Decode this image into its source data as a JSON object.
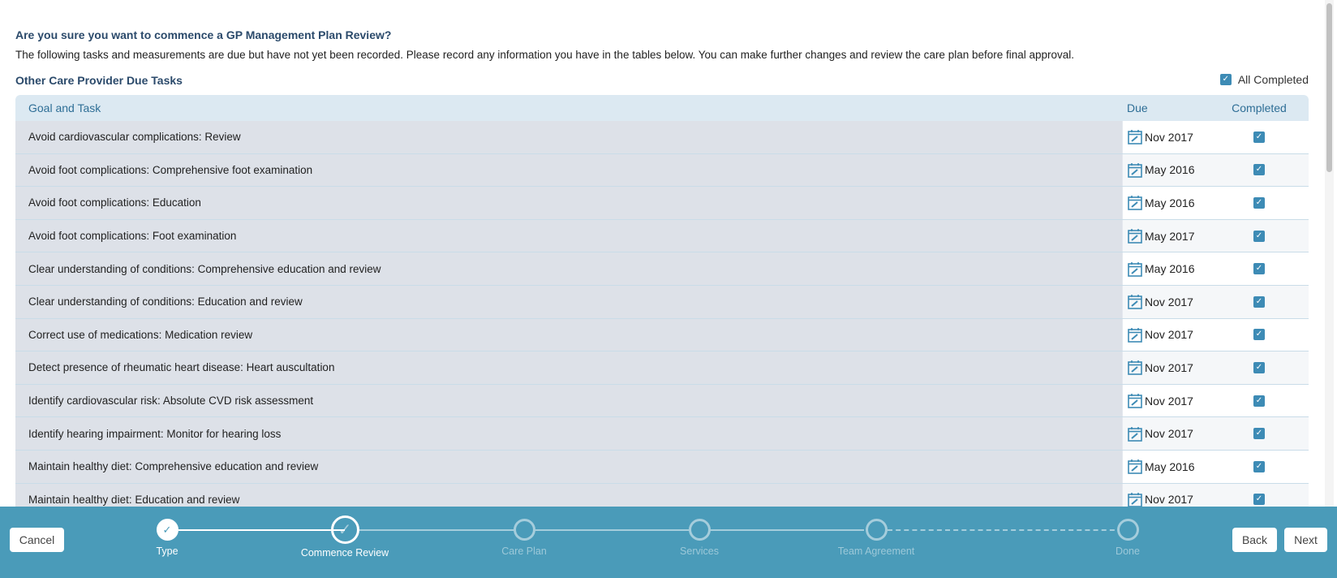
{
  "title": "Are you sure you want to commence a GP Management Plan Review?",
  "description": "The following tasks and measurements are due but have not yet been recorded. Please record any information you have in the tables below. You can make further changes and review the care plan before final approval.",
  "section_title": "Other Care Provider Due Tasks",
  "all_completed_label": "All Completed",
  "columns": {
    "goal": "Goal and Task",
    "due": "Due",
    "completed": "Completed"
  },
  "rows": [
    {
      "task": "Avoid cardiovascular complications: Review",
      "due": "Nov 2017"
    },
    {
      "task": "Avoid foot complications: Comprehensive foot examination",
      "due": "May 2016"
    },
    {
      "task": "Avoid foot complications: Education",
      "due": "May 2016"
    },
    {
      "task": "Avoid foot complications: Foot examination",
      "due": "May 2017"
    },
    {
      "task": "Clear understanding of conditions: Comprehensive education and review",
      "due": "May 2016"
    },
    {
      "task": "Clear understanding of conditions: Education and review",
      "due": "Nov 2017"
    },
    {
      "task": "Correct use of medications: Medication review",
      "due": "Nov 2017"
    },
    {
      "task": "Detect presence of rheumatic heart disease: Heart auscultation",
      "due": "Nov 2017"
    },
    {
      "task": "Identify cardiovascular risk: Absolute CVD risk assessment",
      "due": "Nov 2017"
    },
    {
      "task": "Identify hearing impairment: Monitor for hearing loss",
      "due": "Nov 2017"
    },
    {
      "task": "Maintain healthy diet: Comprehensive education and review",
      "due": "May 2016"
    },
    {
      "task": "Maintain healthy diet: Education and review",
      "due": "Nov 2017"
    }
  ],
  "footer": {
    "cancel": "Cancel",
    "back": "Back",
    "next": "Next",
    "steps": [
      {
        "label": "Type",
        "state": "done"
      },
      {
        "label": "Commence Review",
        "state": "current"
      },
      {
        "label": "Care Plan",
        "state": "pending"
      },
      {
        "label": "Services",
        "state": "pending"
      },
      {
        "label": "Team Agreement",
        "state": "pending"
      },
      {
        "label": "Done",
        "state": "pending"
      }
    ]
  },
  "colors": {
    "accent": "#4a9bb9",
    "heading": "#2b4a6b",
    "checkbox": "#3d8bb5"
  }
}
